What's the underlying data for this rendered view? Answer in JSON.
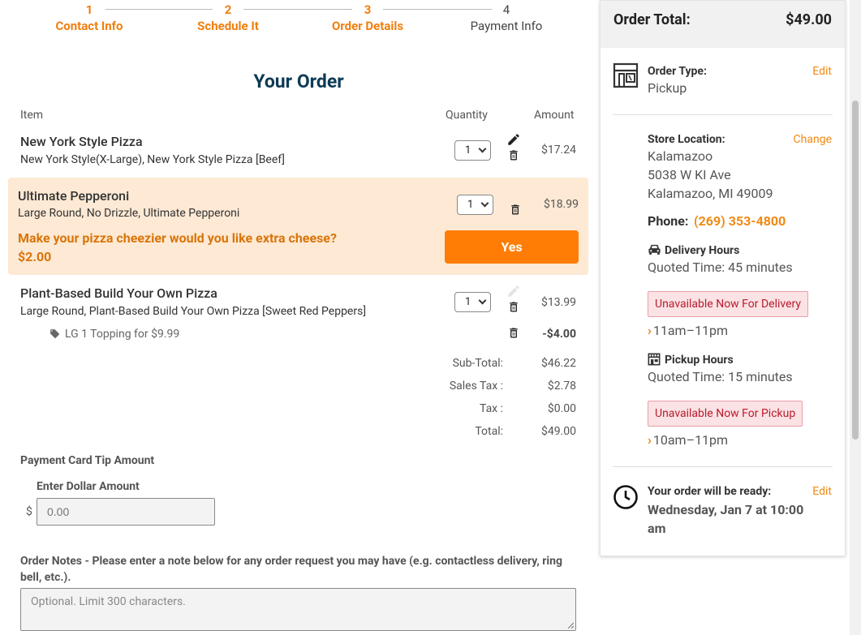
{
  "stepper": {
    "steps": [
      {
        "num": "1",
        "label": "Contact Info"
      },
      {
        "num": "2",
        "label": "Schedule It"
      },
      {
        "num": "3",
        "label": "Order Details"
      },
      {
        "num": "4",
        "label": "Payment Info"
      }
    ]
  },
  "order": {
    "title": "Your Order",
    "columns": {
      "item": "Item",
      "quantity": "Quantity",
      "amount": "Amount"
    },
    "items": [
      {
        "name": "New York Style Pizza",
        "desc": "New York Style(X-Large), New York Style Pizza [Beef]",
        "qty": "1",
        "amount": "$17.24"
      },
      {
        "name": "Ultimate Pepperoni",
        "desc": "Large Round, No Drizzle, Ultimate Pepperoni",
        "qty": "1",
        "amount": "$18.99"
      },
      {
        "name": "Plant-Based Build Your Own Pizza",
        "desc": "Large Round, Plant-Based Build Your Own Pizza [Sweet Red Peppers]",
        "qty": "1",
        "amount": "$13.99"
      }
    ],
    "upsell": {
      "question": "Make your pizza cheezier would you like extra cheese?",
      "price": "$2.00",
      "button": "Yes"
    },
    "coupon": {
      "label": "LG 1 Topping for $9.99",
      "amount": "-$4.00"
    },
    "summary": [
      {
        "label": "Sub-Total:",
        "value": "$46.22"
      },
      {
        "label": "Sales Tax :",
        "value": "$2.78"
      },
      {
        "label": "Tax :",
        "value": "$0.00"
      },
      {
        "label": "Total:",
        "value": "$49.00"
      }
    ]
  },
  "tip": {
    "title": "Payment Card Tip Amount",
    "subtitle": "Enter Dollar Amount",
    "currency": "$",
    "placeholder": "0.00"
  },
  "notes": {
    "title": "Order Notes - Please enter a note below for any order request you may have (e.g. contactless delivery, ring bell, etc.).",
    "placeholder": "Optional. Limit 300 characters."
  },
  "panel": {
    "total_label": "Order Total:",
    "total_value": "$49.00",
    "order_type_label": "Order Type:",
    "order_type_value": "Pickup",
    "edit": "Edit",
    "store_label": "Store Location:",
    "change": "Change",
    "store_name": "Kalamazoo",
    "store_street": "5038 W KI Ave",
    "store_city": "Kalamazoo, MI 49009",
    "phone_label": "Phone:",
    "phone": "(269) 353-4800",
    "delivery_label": "Delivery Hours",
    "delivery_quoted": "Quoted Time: 45 minutes",
    "delivery_badge": "Unavailable Now For Delivery",
    "delivery_hours": "11am–11pm",
    "pickup_label": "Pickup Hours",
    "pickup_quoted": "Quoted Time: 15 minutes",
    "pickup_badge": "Unavailable Now For Pickup",
    "pickup_hours": "10am–11pm",
    "ready_label": "Your order will be ready:",
    "ready_value": "Wednesday, Jan 7 at 10:00 am"
  },
  "colors": {
    "accent": "#f07f0e",
    "title": "#0d3a55",
    "button": "#ff7d05",
    "upsell_bg": "#fde9d4",
    "badge_text": "#b81c2e"
  }
}
